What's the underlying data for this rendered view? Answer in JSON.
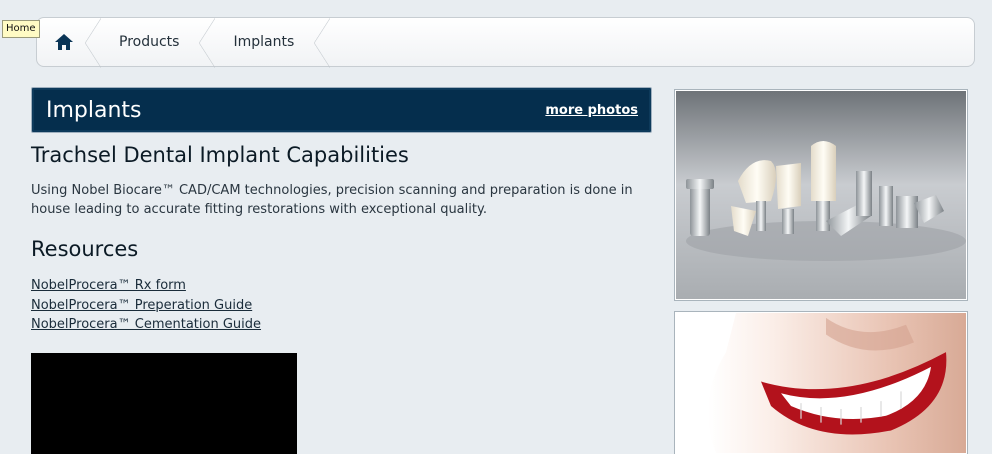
{
  "tooltip": {
    "text": "Home"
  },
  "breadcrumb": {
    "items": [
      {
        "icon": "home-icon"
      },
      {
        "label": "Products"
      },
      {
        "label": "Implants"
      }
    ]
  },
  "section": {
    "title": "Implants",
    "more_photos_label": "more photos"
  },
  "capabilities": {
    "heading": "Trachsel Dental Implant Capabilities",
    "text": "Using Nobel Biocare™ CAD/CAM technologies, precision scanning and preparation is done in house leading to accurate fitting restorations with exceptional quality."
  },
  "resources": {
    "heading": "Resources",
    "links": [
      "NobelProcera™ Rx form",
      "NobelProcera™ Preperation Guide",
      "NobelProcera™ Cementation Guide"
    ]
  },
  "colors": {
    "background": "#e8edf1",
    "header_bg": "#052e4d",
    "link": "#1a2c3a"
  }
}
